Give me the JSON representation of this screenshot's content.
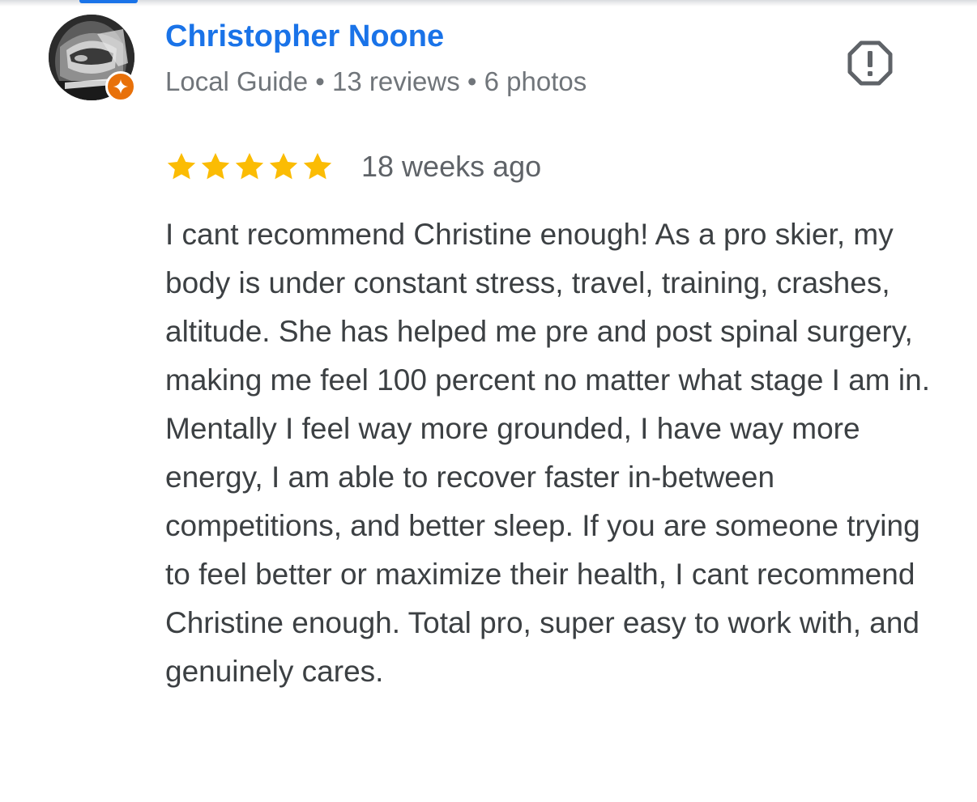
{
  "review": {
    "reviewer_name": "Christopher Noone",
    "reviewer_meta": "Local Guide • 13 reviews • 6 photos",
    "rating": 5,
    "rating_max": 5,
    "date": "18 weeks ago",
    "text": "I cant recommend Christine enough! As a pro skier, my body is under constant stress, travel, training, crashes, altitude. She has helped me pre and post spinal surgery, making me feel 100 percent no matter what stage I am in. Mentally I feel way more grounded, I have way more energy, I am able to recover faster in-between competitions, and better sleep. If you are someone trying to feel better or maximize their health, I cant recommend Christine enough. Total pro, super easy to work with, and genuinely cares."
  },
  "icons": {
    "report": "report-flag-icon",
    "guide_badge": "local-guide-badge-icon",
    "star": "star-icon"
  },
  "colors": {
    "name": "#1a73e8",
    "meta": "#70757a",
    "text": "#3c4043",
    "star": "#fbbc04",
    "badge": "#e8710a",
    "tab_indicator": "#1a73e8"
  }
}
